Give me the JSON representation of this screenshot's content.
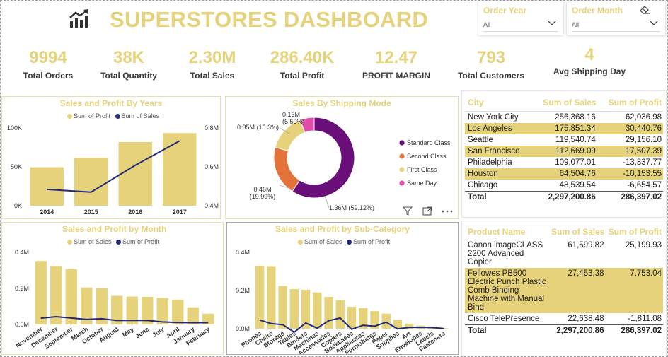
{
  "header": {
    "title": "SUPERSTORES DASHBOARD",
    "logo_icon": "chart-growth-icon"
  },
  "filters": [
    {
      "label": "Order Year",
      "value": "All"
    },
    {
      "label": "Order Month",
      "value": "All"
    }
  ],
  "kpis": [
    {
      "value": "9994",
      "label": "Total Orders"
    },
    {
      "value": "38K",
      "label": "Total Quantity"
    },
    {
      "value": "2.30M",
      "label": "Total Sales"
    },
    {
      "value": "286.40K",
      "label": "Total Profit"
    },
    {
      "value": "12.47",
      "label": "PROFIT MARGIN"
    },
    {
      "value": "793",
      "label": "Total Customers"
    },
    {
      "value": "4",
      "label": "Avg Shipping Day"
    }
  ],
  "colors": {
    "gold": "#e6d27a",
    "navy": "#1f2a7a",
    "purple": "#6a0f7a",
    "orange": "#e3733a",
    "pink": "#e04ca8",
    "light_gold": "#f0e4a8"
  },
  "chart_data": [
    {
      "type": "bar",
      "title": "Sales and Profit By Years",
      "legend": [
        "Sum of Profit",
        "Sum of Sales"
      ],
      "categories": [
        "2014",
        "2015",
        "2016",
        "2017"
      ],
      "series": [
        {
          "name": "Sum of Profit",
          "values": [
            49500,
            61600,
            81800,
            93400
          ],
          "axis": "left"
        },
        {
          "name": "Sum of Sales",
          "values": [
            484000,
            470000,
            608000,
            733000
          ],
          "axis": "right"
        }
      ],
      "y_ticks_left": [
        "0K",
        "50K",
        "100K"
      ],
      "y_ticks_right": [
        "0.4M",
        "0.6M",
        "0.8M"
      ],
      "ylim_left": [
        0,
        100000
      ],
      "ylim_right": [
        400000,
        800000
      ]
    },
    {
      "type": "pie",
      "title": "Sales By Shipping Mode",
      "slices": [
        {
          "name": "Standard Class",
          "value": 1.36,
          "label": "1.36M (59.12%)",
          "color": "#6a0f7a"
        },
        {
          "name": "Second Class",
          "value": 0.46,
          "label": "0.46M (19.99%)",
          "color": "#e3733a"
        },
        {
          "name": "First Class",
          "value": 0.35,
          "label": "0.35M (15.3%)",
          "color": "#e6d27a"
        },
        {
          "name": "Same Day",
          "value": 0.13,
          "label": "0.13M (5.59%)",
          "color": "#e04ca8"
        }
      ]
    },
    {
      "type": "bar",
      "title": "Sales and Profit by Month",
      "legend": [
        "Sum of Sales",
        "Sum of Profit"
      ],
      "categories": [
        "November",
        "December",
        "September",
        "March",
        "October",
        "August",
        "May",
        "June",
        "July",
        "April",
        "January",
        "February"
      ],
      "series": [
        {
          "name": "Sum of Sales",
          "values": [
            0.352,
            0.325,
            0.307,
            0.205,
            0.2,
            0.159,
            0.155,
            0.153,
            0.147,
            0.138,
            0.095,
            0.06
          ]
        },
        {
          "name": "Sum of Profit",
          "values": [
            0.035,
            0.043,
            0.036,
            0.028,
            0.032,
            0.022,
            0.023,
            0.022,
            0.014,
            0.011,
            0.01,
            0.01
          ]
        }
      ],
      "y_ticks": [
        "0.0M",
        "0.2M",
        "0.4M"
      ],
      "ylim": [
        0,
        0.4
      ]
    },
    {
      "type": "bar",
      "title": "Sales and Profit by Sub-Category",
      "legend": [
        "Sum of Sales",
        "Sum of Profit"
      ],
      "categories": [
        "Phones",
        "Chairs",
        "Storage",
        "Tables",
        "Binders",
        "Machines",
        "Accessories",
        "Copiers",
        "Bookcases",
        "Appliances",
        "Furnishings",
        "Paper",
        "Supplies",
        "Art",
        "Envelopes",
        "Labels",
        "Fasteners"
      ],
      "series": [
        {
          "name": "Sum of Sales",
          "values": [
            0.33,
            0.328,
            0.224,
            0.207,
            0.204,
            0.19,
            0.167,
            0.15,
            0.115,
            0.108,
            0.092,
            0.079,
            0.047,
            0.027,
            0.016,
            0.012,
            0.003
          ]
        },
        {
          "name": "Sum of Profit",
          "values": [
            0.045,
            0.027,
            0.021,
            -0.018,
            0.03,
            0.003,
            0.042,
            0.056,
            -0.003,
            0.018,
            0.013,
            0.034,
            -0.001,
            0.007,
            0.007,
            0.006,
            0.001
          ]
        }
      ],
      "y_ticks": [
        "0.0M",
        "0.2M",
        "0.4M"
      ],
      "ylim": [
        0,
        0.4
      ]
    },
    {
      "type": "table",
      "columns": [
        "City",
        "Sum of Sales",
        "Sum of Profit"
      ],
      "rows": [
        [
          "New York City",
          "256,368.16",
          "62,036.98"
        ],
        [
          "Los Angeles",
          "175,851.34",
          "30,440.76"
        ],
        [
          "Seattle",
          "119,540.74",
          "29,156.10"
        ],
        [
          "San Francisco",
          "112,669.09",
          "17,507.39"
        ],
        [
          "Philadelphia",
          "109,077.01",
          "-13,837.77"
        ],
        [
          "Houston",
          "64,504.76",
          "-10,153.55"
        ],
        [
          "Chicago",
          "48,539.54",
          "-6,654.57"
        ]
      ],
      "total": [
        "Total",
        "2,297,200.86",
        "286,397.02"
      ]
    },
    {
      "type": "table",
      "columns": [
        "Product Name",
        "Sum of Sales",
        "Sum of Profit"
      ],
      "rows": [
        [
          "Canon imageCLASS 2200 Advanced Copier",
          "61,599.82",
          "25,199.93"
        ],
        [
          "Fellowes PB500 Electric Punch Plastic Comb Binding Machine with Manual Bind",
          "27,453.38",
          "7,753.04"
        ],
        [
          "Cisco TelePresence",
          "22,638.48",
          "-1,811.08"
        ]
      ],
      "total": [
        "Total",
        "2,297,200.86",
        "286,397.02"
      ]
    }
  ]
}
